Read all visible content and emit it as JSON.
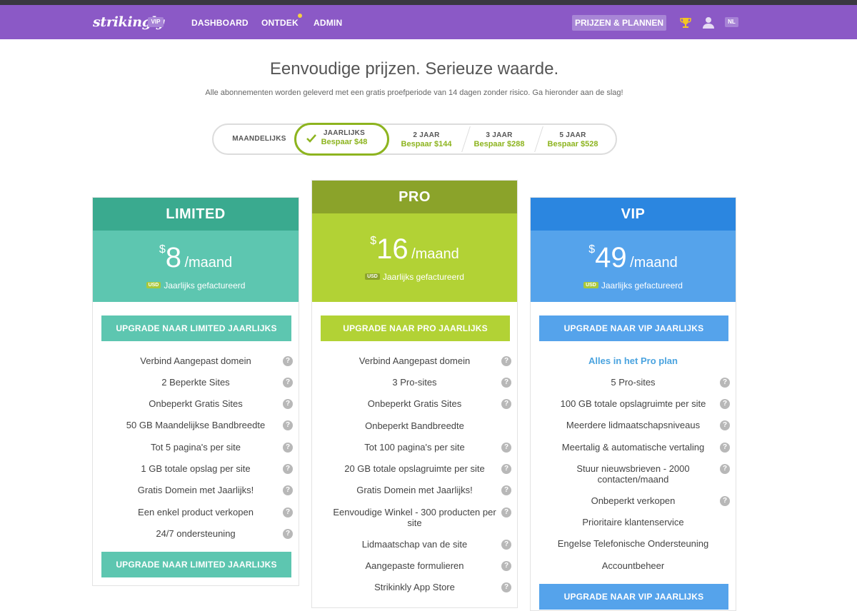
{
  "nav": {
    "logo": "strikingly",
    "vip_tag": "VIP",
    "links": [
      "DASHBOARD",
      "ONTDEK",
      "ADMIN"
    ],
    "pricing_button": "PRIJZEN & PLANNEN",
    "lang": "NL",
    "icons": [
      "trophy-icon",
      "user-icon"
    ],
    "accent": "#8b59c6"
  },
  "hero": {
    "title": "Eenvoudige prijzen. Serieuze waarde.",
    "subtitle": "Alle abonnementen worden geleverd met een gratis proefperiode van 14 dagen zonder risico. Ga hieronder aan de slag!"
  },
  "periods": [
    {
      "label": "MAANDELIJKS",
      "save": ""
    },
    {
      "label": "JAARLIJKS",
      "save": "Bespaar $48",
      "selected": true
    },
    {
      "label": "2 JAAR",
      "save": "Bespaar $144"
    },
    {
      "label": "3 JAAR",
      "save": "Bespaar $288"
    },
    {
      "label": "5 JAAR",
      "save": "Bespaar $528"
    }
  ],
  "plans": [
    {
      "name": "LIMITED",
      "currency": "$",
      "amount": "8",
      "unit": "/maand",
      "usd": "USD",
      "billed": "Jaarlijks gefactureerd",
      "cta": "UPGRADE NAAR LIMITED JAARLIJKS",
      "colors": {
        "head": "#3aaa8f",
        "price": "#5dc6b0",
        "button": "#5dc6b0"
      },
      "features": [
        "Verbind Aangepast domein",
        "2 Beperkte Sites",
        "Onbeperkt Gratis Sites",
        "50 GB Maandelijkse Bandbreedte",
        "Tot 5 pagina's per site",
        "1 GB totale opslag per site",
        "Gratis Domein met Jaarlijks!",
        "Een enkel product verkopen",
        "24/7 ondersteuning"
      ]
    },
    {
      "name": "PRO",
      "currency": "$",
      "amount": "16",
      "unit": "/maand",
      "usd": "USD",
      "billed": "Jaarlijks gefactureerd",
      "cta": "UPGRADE NAAR PRO JAARLIJKS",
      "colors": {
        "head": "#8ba32a",
        "price": "#b2d235",
        "button": "#b2d235"
      },
      "features": [
        "Verbind Aangepast domein",
        "3 Pro-sites",
        "Onbeperkt Gratis Sites",
        "Onbeperkt Bandbreedte",
        "Tot 100 pagina's per site",
        "20 GB totale opslagruimte per site",
        "Gratis Domein met Jaarlijks!",
        "Eenvoudige Winkel - 300 producten per site",
        "Lidmaatschap van de site",
        "Aangepaste formulieren",
        "Strikinkly App Store"
      ]
    },
    {
      "name": "VIP",
      "currency": "$",
      "amount": "49",
      "unit": "/maand",
      "usd": "USD",
      "billed": "Jaarlijks gefactureerd",
      "cta": "UPGRADE NAAR VIP JAARLIJKS",
      "colors": {
        "head": "#2b86e0",
        "price": "#55a3eb",
        "button": "#55a3eb"
      },
      "features": [
        "Alles in het Pro plan",
        "5 Pro-sites",
        "100 GB totale opslagruimte per site",
        "Meerdere lidmaatschapsniveaus",
        "Meertalig & automatische vertaling",
        "Stuur nieuwsbrieven - 2000 contacten/maand",
        "Onbeperkt verkopen",
        "Prioritaire klantenservice",
        "Engelse Telefonische Ondersteuning",
        "Accountbeheer"
      ]
    }
  ]
}
